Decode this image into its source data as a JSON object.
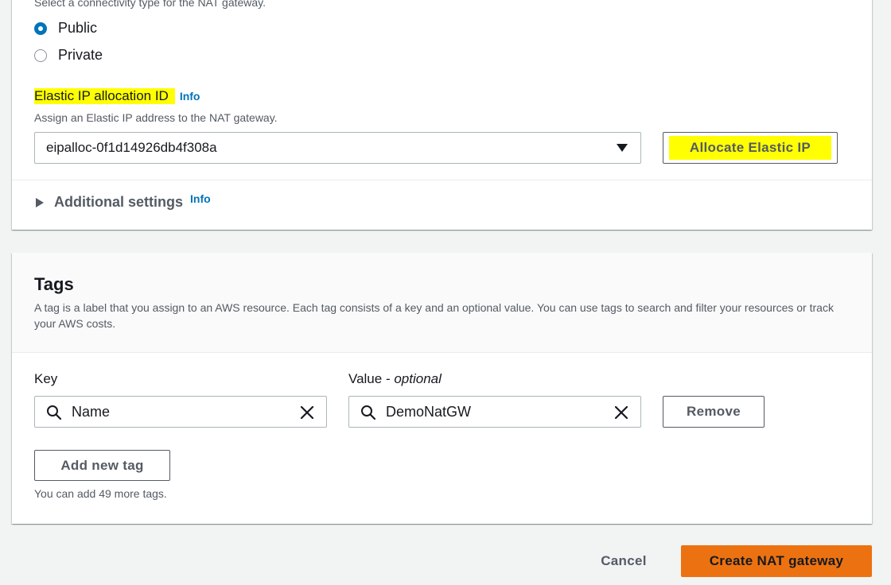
{
  "connectivity": {
    "description": "Select a connectivity type for the NAT gateway.",
    "options": [
      {
        "label": "Public",
        "selected": true
      },
      {
        "label": "Private",
        "selected": false
      }
    ]
  },
  "elastic_ip": {
    "label": "Elastic IP allocation ID",
    "info": "Info",
    "description": "Assign an Elastic IP address to the NAT gateway.",
    "selected_value": "eipalloc-0f1d14926db4f308a",
    "allocate_button": "Allocate Elastic IP"
  },
  "additional_settings": {
    "label": "Additional settings",
    "info": "Info"
  },
  "tags": {
    "title": "Tags",
    "description": "A tag is a label that you assign to an AWS resource. Each tag consists of a key and an optional value. You can use tags to search and filter your resources or track your AWS costs.",
    "key_label": "Key",
    "value_label": "Value - ",
    "value_optional": "optional",
    "rows": [
      {
        "key": "Name",
        "value": "DemoNatGW",
        "remove": "Remove"
      }
    ],
    "add_button": "Add new tag",
    "remaining_text": "You can add 49 more tags."
  },
  "footer": {
    "cancel": "Cancel",
    "create": "Create NAT gateway"
  },
  "colors": {
    "primary": "#ec7211",
    "link": "#0073bb",
    "highlight": "#ffff00"
  }
}
